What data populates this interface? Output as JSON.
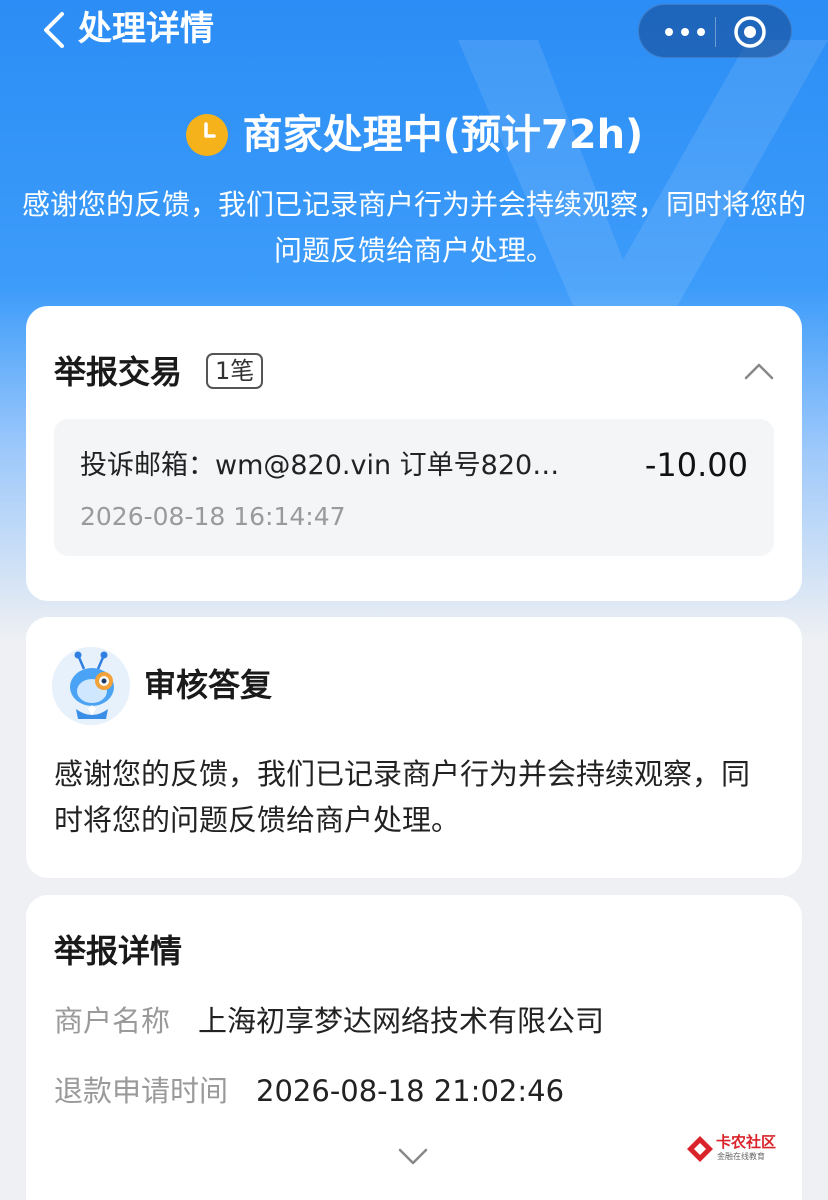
{
  "header": {
    "title": "处理详情"
  },
  "status": {
    "title": "商家处理中(预计72h)",
    "description": "感谢您的反馈，我们已记录商户行为并会持续观察，同时将您的问题反馈给商户处理。"
  },
  "report_transaction": {
    "title": "举报交易",
    "count_badge": "1笔",
    "item": {
      "description": "投诉邮箱：wm@820.vin 订单号820…",
      "amount": "-10.00",
      "time": "2026-08-18 16:14:47"
    }
  },
  "review_reply": {
    "title": "审核答复",
    "body": "感谢您的反馈，我们已记录商户行为并会持续观察，同时将您的问题反馈给商户处理。"
  },
  "report_details": {
    "title": "举报详情",
    "fields": [
      {
        "label": "商户名称",
        "value": "上海初享梦达网络技术有限公司"
      },
      {
        "label": "退款申请时间",
        "value": "2026-08-18 21:02:46"
      }
    ]
  },
  "watermark_logo": {
    "name": "卡农社区",
    "tagline": "金融在线教育"
  },
  "colors": {
    "brand_blue": "#2b8df5",
    "status_clock": "#f6b21b",
    "logo_red": "#d8242a"
  }
}
